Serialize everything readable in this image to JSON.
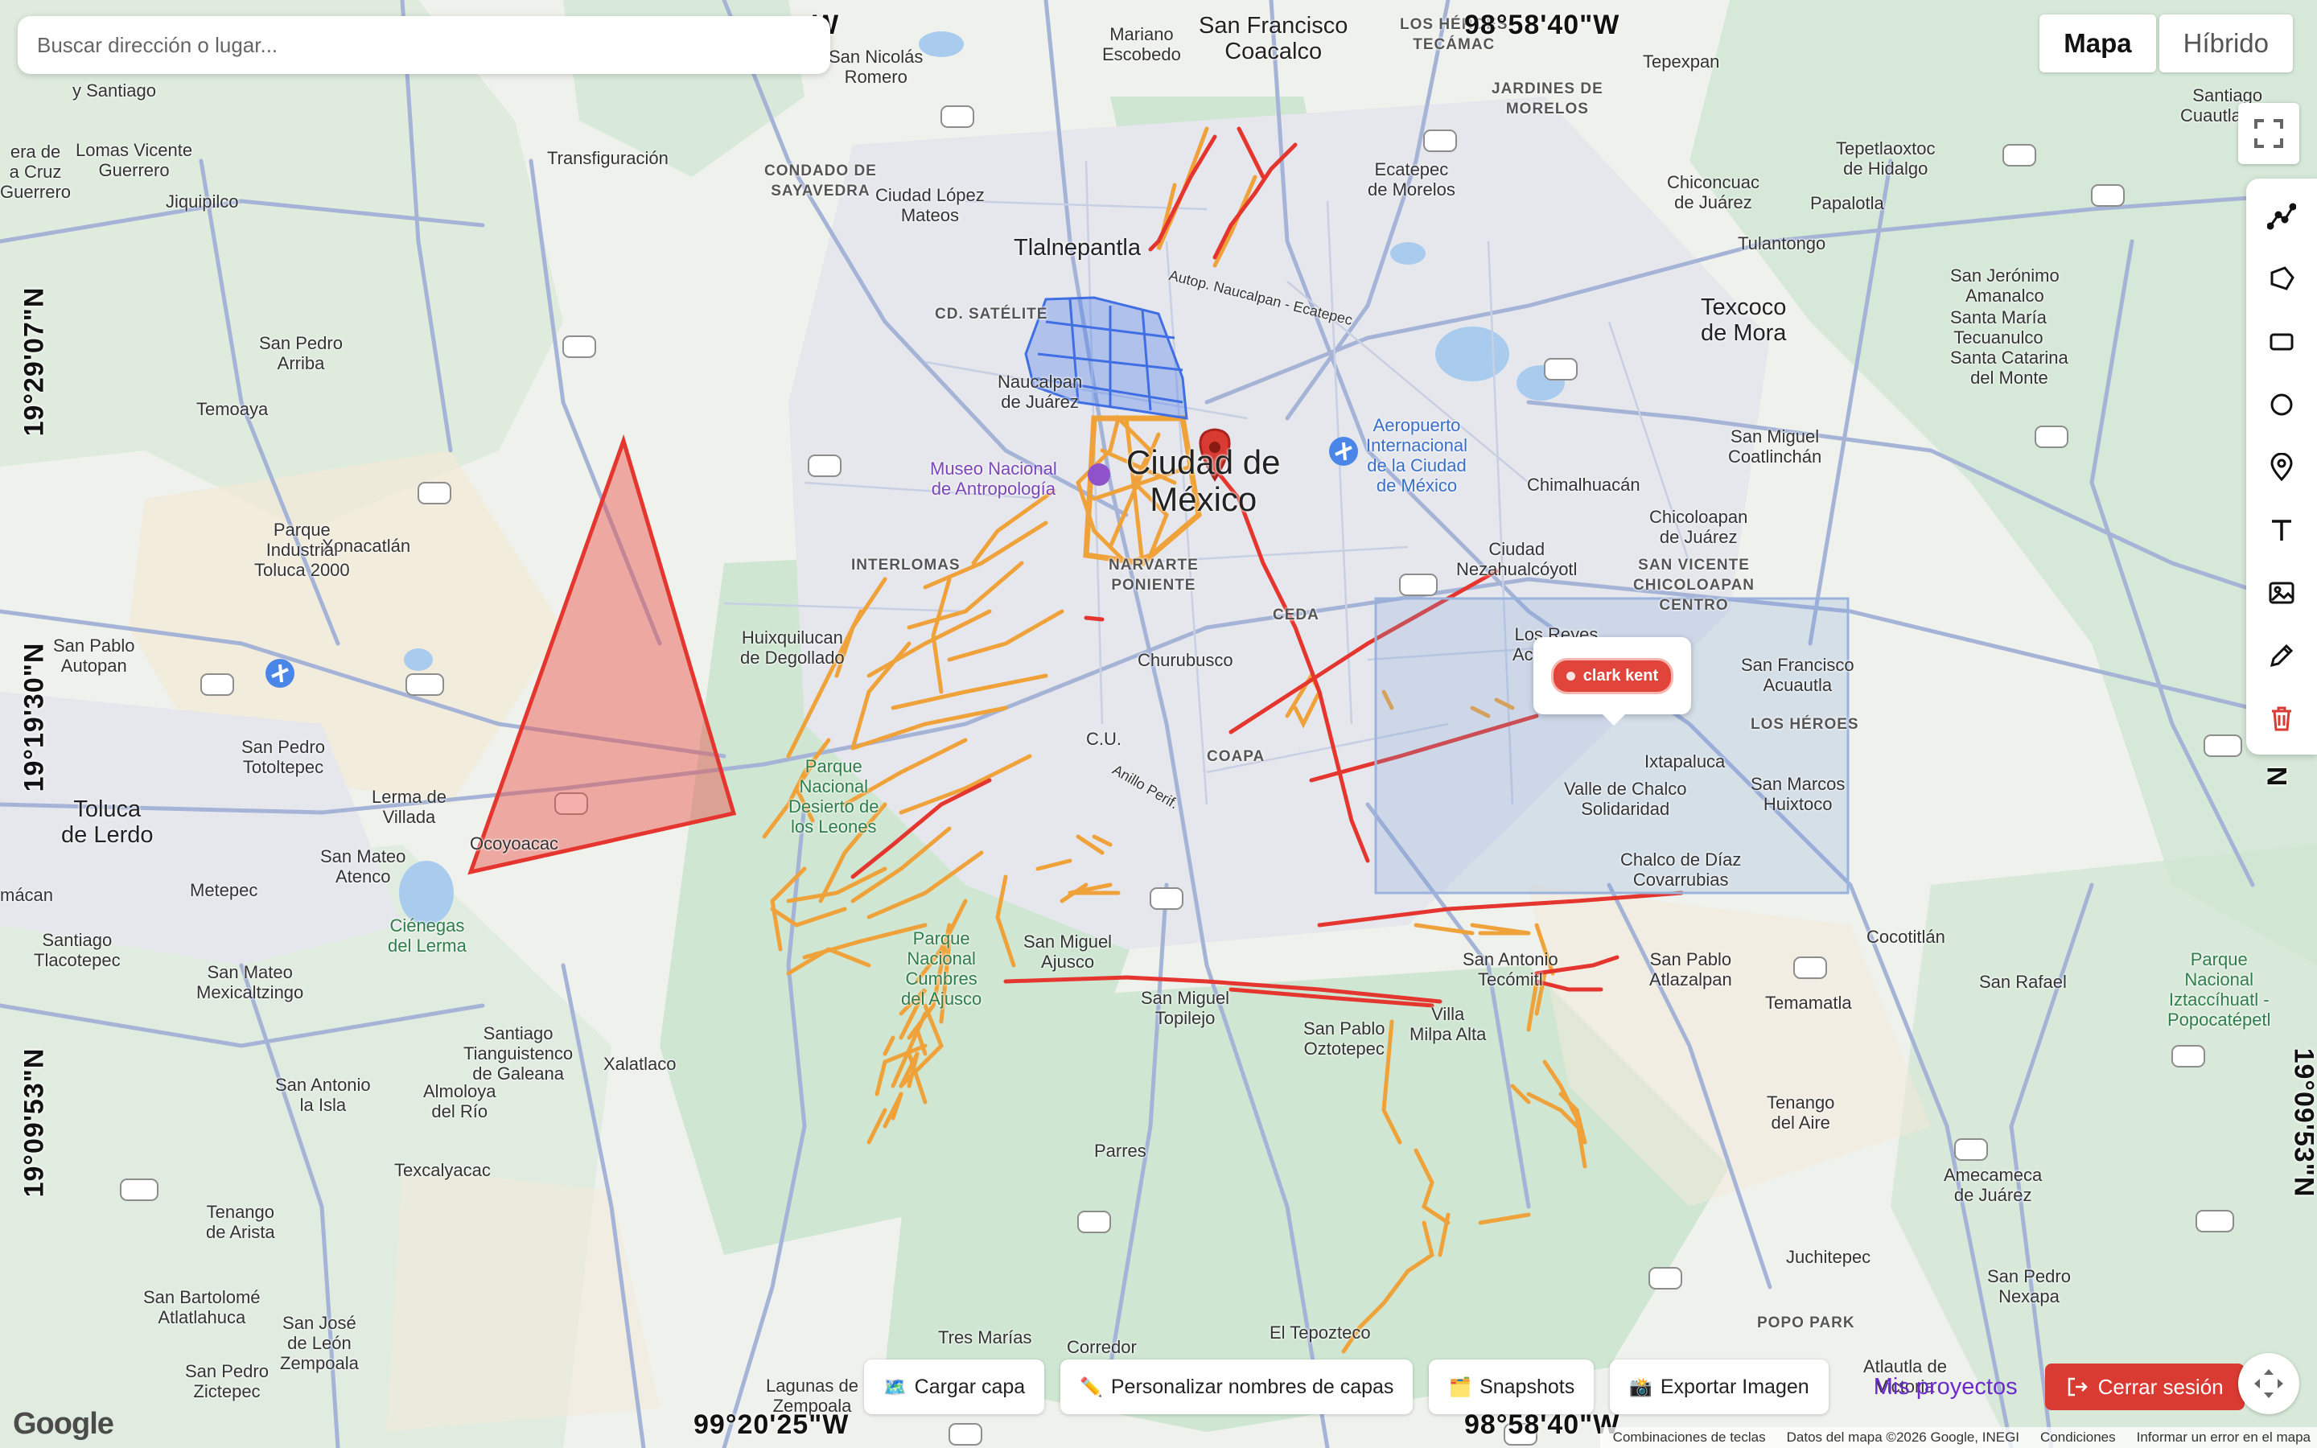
{
  "search": {
    "placeholder": "Buscar dirección o lugar..."
  },
  "map_type": {
    "options": [
      "Mapa",
      "Híbrido"
    ],
    "selected": "Mapa"
  },
  "drawing_tools": [
    "polyline-tool",
    "polygon-tool",
    "rectangle-tool",
    "circle-tool",
    "marker-tool",
    "text-tool",
    "image-tool",
    "edit-tool",
    "delete-tool"
  ],
  "coordinates": {
    "top_left": "W",
    "top_right": "98°58'40\"W",
    "bottom_left": "99°20'25\"W",
    "bottom_right": "98°58'40\"W",
    "left_top": "19°29'07\"N",
    "left_mid": "19°19'30\"N",
    "left_bottom": "19°09'53\"N",
    "right_top": "N",
    "right_bottom": "19°09'53\"N"
  },
  "marker_label": "clark kent",
  "bottom_bar": {
    "load_layer": "Cargar capa",
    "rename_layers": "Personalizar nombres de capas",
    "snapshots": "Snapshots",
    "export_image": "Exportar Imagen",
    "projects": "Mis proyectos",
    "logout": "Cerrar sesión"
  },
  "attribution": {
    "logo": "Google",
    "shortcuts": "Combinaciones de teclas",
    "map_data": "Datos del mapa ©2026 Google, INEGI",
    "terms": "Condiciones",
    "report": "Informar un error en el mapa"
  },
  "places": {
    "san_francisco": "San Francisco\nCoacalco",
    "los_heroes_tecamac": "LOS HÉROES\nTECÁMAC",
    "tepexpan": "Tepexpan",
    "jardines": "JARDINES DE\nMORELOS",
    "santiago": "Santiago\nCuautlalpan",
    "mariano": "Mariano\nEscobedo",
    "nicolas": "San Nicolás\nRomero",
    "sanjose": "y Santiago",
    "transfiguracion": "Transfiguración",
    "condado": "CONDADO DE\nSAYAVEDRA",
    "lopez_mateos": "Ciudad López\nMateos",
    "tlalnepantla": "Tlalnepantla",
    "ecatepec": "Ecatepec\nde Morelos",
    "tepetlaoxtoc": "Tepetlaoxtoc\nde Hidalgo",
    "chiconcuac": "Chiconcuac\nde Juárez",
    "papalotla": "Papalotla",
    "tulantongo": "Tulantongo",
    "texcoco": "Texcoco\nde Mora",
    "san_jeronimo": "San Jerónimo\nAmanalco",
    "santa_maria": "Santa María\nTecuanulco",
    "santa_catarina": "Santa Catarina\ndel Monte",
    "satelite": "CD. SATÉLITE",
    "naucalpan": "Naucalpan\nde Juárez",
    "aeropuerto": "Aeropuerto\nInternacional\nde la Ciudad\nde México",
    "cdmx": "Ciudad de\nMéxico",
    "museo": "Museo Nacional\nde Antropología",
    "san_miguel_coatlinchan": "San Miguel\nCoatlinchán",
    "chimalhuacan": "Chimalhuacán",
    "chicoloapan": "Chicoloapan\nde Juárez",
    "nezahualcoyotl": "Ciudad\nNezahualcóyotl",
    "san_vicente": "SAN VICENTE\nCHICOLOAPAN\nCENTRO",
    "interlomas": "INTERLOMAS",
    "narvarte": "NARVARTE\nPONIENTE",
    "ceda": "CEDA",
    "los_reyes": "Los Reyes\nAcaquilpan",
    "san_francisco_acuautla": "San Francisco\nAcuautla",
    "los_heroes": "LOS HÉROES",
    "huixquilucan": "Huixquilucan\nde Degollado",
    "churubusco": "Churubusco",
    "cu": "C.U.",
    "coapa": "COAPA",
    "ixtapaluca": "Ixtapaluca",
    "valle_chalco": "Valle de Chalco\nSolidaridad",
    "san_marcos": "San Marcos\nHuixtoco",
    "chalco": "Chalco de Díaz\nCovarrubias",
    "cocotitlan": "Cocotitlán",
    "san_rafael": "San Rafael",
    "izta": "Parque\nNacional\nIztaccíhuatl -\nPopocatépetl",
    "temamatla": "Temamatla",
    "san_pablo_atlazalpan": "San Pablo\nAtlazalpan",
    "san_antonio": "San Antonio\nTecómitl",
    "xonacatlan": "Xonacatlán",
    "temoaya": "Temoaya",
    "san_pedro_arriba": "San Pedro\nArriba",
    "lomas_guerrero": "Lomas Vicente\nGuerrero",
    "cruz": "era de\na Cruz\nGuerrero",
    "jiquipilco": "Jiquipilco",
    "parque_industrial": "Parque\nIndustrial\nToluca 2000",
    "san_pablo_autopan": "San Pablo\nAutopan",
    "san_pedro_totoltepec": "San Pedro\nTotoltepec",
    "toluca": "Toluca\nde Lerdo",
    "lerma": "Lerma de\nVillada",
    "ocoyoacac": "Ocoyoacac",
    "san_mateo_atenco": "San Mateo\nAtenco",
    "metepec": "Metepec",
    "macan": "mácan",
    "cienegas": "Ciénegas\ndel Lerma",
    "santiago_tlacotepec": "Santiago\nTlacotepec",
    "san_mateo_mexicaltzingo": "San Mateo\nMexicaltzingo",
    "santiago_tianguistenco": "Santiago\nTianguistenco\nde Galeana",
    "xalatlaco": "Xalatlaco",
    "san_antonio_isla": "San Antonio\nla Isla",
    "almoloya": "Almoloya\ndel Río",
    "texcalyacac": "Texcalyacac",
    "tenango": "Tenango\nde Arista",
    "san_bartolome": "San Bartolomé\nAtlatlahuca",
    "san_jose_leon": "San José\nde León\nZempoala",
    "san_pedro_zictepec": "San Pedro\nZictepec",
    "desierto": "Parque\nNacional\nDesierto de\nlos Leones",
    "cumbres": "Parque\nNacional\nCumbres\ndel Ajusco",
    "san_miguel_ajusco": "San Miguel\nAjusco",
    "san_miguel_topilejo": "San Miguel\nTopilejo",
    "san_pablo_oztotepec": "San Pablo\nOztotepec",
    "villa_milpa_alta": "Villa\nMilpa Alta",
    "parres": "Parres",
    "tres_marias": "Tres Marías",
    "corredor": "Corredor",
    "el_tepozteco": "El Tepozteco",
    "lagunas": "Lagunas de\nZempoala",
    "amecameca": "Amecameca\nde Juárez",
    "tenango_aire": "Tenango\ndel Aire",
    "juchitepec": "Juchitepec",
    "san_pedro_nexapa": "San Pedro\nNexapa",
    "popo_park": "POPO PARK",
    "atlautla": "Atlautla de\nVictoria",
    "anillo": "Anillo Perif.",
    "autop": "Autop. Naucalpan - Ecatepec"
  }
}
